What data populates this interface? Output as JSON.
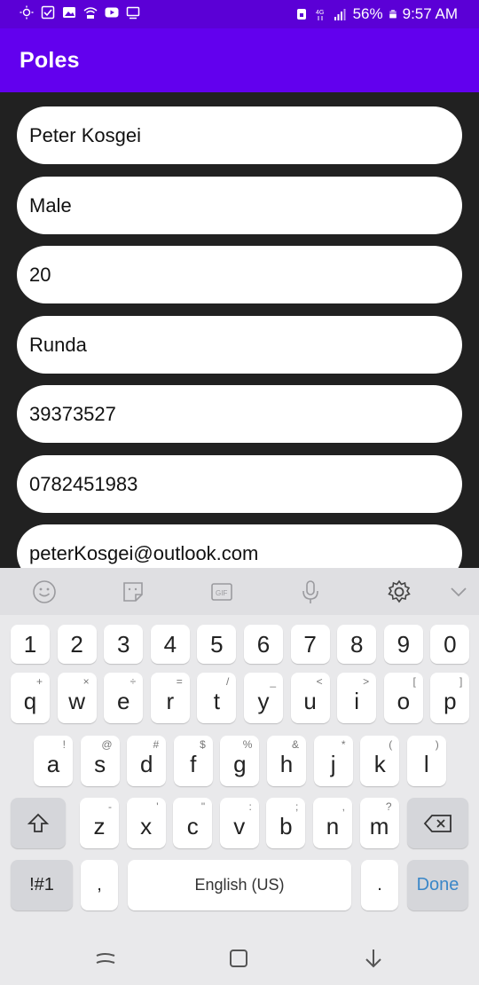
{
  "status_bar": {
    "left_icons": [
      "brightness-icon",
      "checkbox-icon",
      "image-icon",
      "wifi-hotspot-icon",
      "youtube-icon",
      "cast-icon"
    ],
    "right_icons": [
      "nfc-lock-icon",
      "4g-icon",
      "signal-icon"
    ],
    "battery": "56%",
    "time": "9:57 AM"
  },
  "app_bar": {
    "title": "Poles"
  },
  "form": {
    "fields": [
      {
        "value": "Peter Kosgei"
      },
      {
        "value": "Male"
      },
      {
        "value": "20"
      },
      {
        "value": "Runda"
      },
      {
        "value": "39373527"
      },
      {
        "value": "0782451983"
      },
      {
        "value": "peterKosgei@outlook.com"
      }
    ]
  },
  "keyboard": {
    "toolbar_icons": [
      "emoji-icon",
      "sticker-icon",
      "gif-icon",
      "microphone-icon",
      "settings-icon",
      "chevron-down-icon"
    ],
    "number_row": [
      "1",
      "2",
      "3",
      "4",
      "5",
      "6",
      "7",
      "8",
      "9",
      "0"
    ],
    "row1": [
      {
        "key": "q",
        "hint": "+"
      },
      {
        "key": "w",
        "hint": "×"
      },
      {
        "key": "e",
        "hint": "÷"
      },
      {
        "key": "r",
        "hint": "="
      },
      {
        "key": "t",
        "hint": "/"
      },
      {
        "key": "y",
        "hint": "_"
      },
      {
        "key": "u",
        "hint": "<"
      },
      {
        "key": "i",
        "hint": ">"
      },
      {
        "key": "o",
        "hint": "["
      },
      {
        "key": "p",
        "hint": "]"
      }
    ],
    "row2": [
      {
        "key": "a",
        "hint": "!"
      },
      {
        "key": "s",
        "hint": "@"
      },
      {
        "key": "d",
        "hint": "#"
      },
      {
        "key": "f",
        "hint": "$"
      },
      {
        "key": "g",
        "hint": "%"
      },
      {
        "key": "h",
        "hint": "&"
      },
      {
        "key": "j",
        "hint": "*"
      },
      {
        "key": "k",
        "hint": "("
      },
      {
        "key": "l",
        "hint": ")"
      }
    ],
    "row3": [
      {
        "key": "z",
        "hint": "-"
      },
      {
        "key": "x",
        "hint": "'"
      },
      {
        "key": "c",
        "hint": "\""
      },
      {
        "key": "v",
        "hint": ":"
      },
      {
        "key": "b",
        "hint": ";"
      },
      {
        "key": "n",
        "hint": ","
      },
      {
        "key": "m",
        "hint": "?"
      }
    ],
    "symbols_label": "!#1",
    "comma_label": ",",
    "space_label": "English (US)",
    "period_label": ".",
    "done_label": "Done"
  },
  "nav_bar": {
    "icons": [
      "recents-icon",
      "home-icon",
      "back-icon"
    ]
  },
  "colors": {
    "app_bar": "#6200ee",
    "status_bar": "#5b00d6",
    "form_bg": "#212121",
    "done": "#3a87c8"
  }
}
